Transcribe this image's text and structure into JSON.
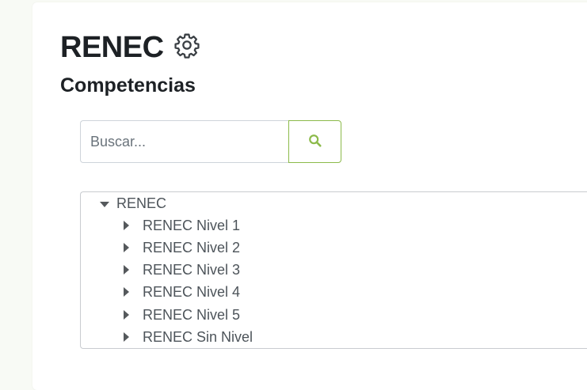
{
  "header": {
    "title": "RENEC",
    "settings_icon": "gear-icon",
    "subtitle": "Competencias"
  },
  "search": {
    "placeholder": "Buscar...",
    "value": "",
    "button_icon": "search-icon",
    "accent_color": "#8cba4a"
  },
  "tree": {
    "root": {
      "label": "RENEC",
      "expanded": true,
      "icon": "caret-down-icon"
    },
    "children": [
      {
        "label": "RENEC Nivel 1",
        "expanded": false,
        "icon": "caret-right-icon"
      },
      {
        "label": "RENEC Nivel 2",
        "expanded": false,
        "icon": "caret-right-icon"
      },
      {
        "label": "RENEC Nivel 3",
        "expanded": false,
        "icon": "caret-right-icon"
      },
      {
        "label": "RENEC Nivel 4",
        "expanded": false,
        "icon": "caret-right-icon"
      },
      {
        "label": "RENEC Nivel 5",
        "expanded": false,
        "icon": "caret-right-icon"
      },
      {
        "label": "RENEC Sin Nivel",
        "expanded": false,
        "icon": "caret-right-icon"
      }
    ]
  }
}
